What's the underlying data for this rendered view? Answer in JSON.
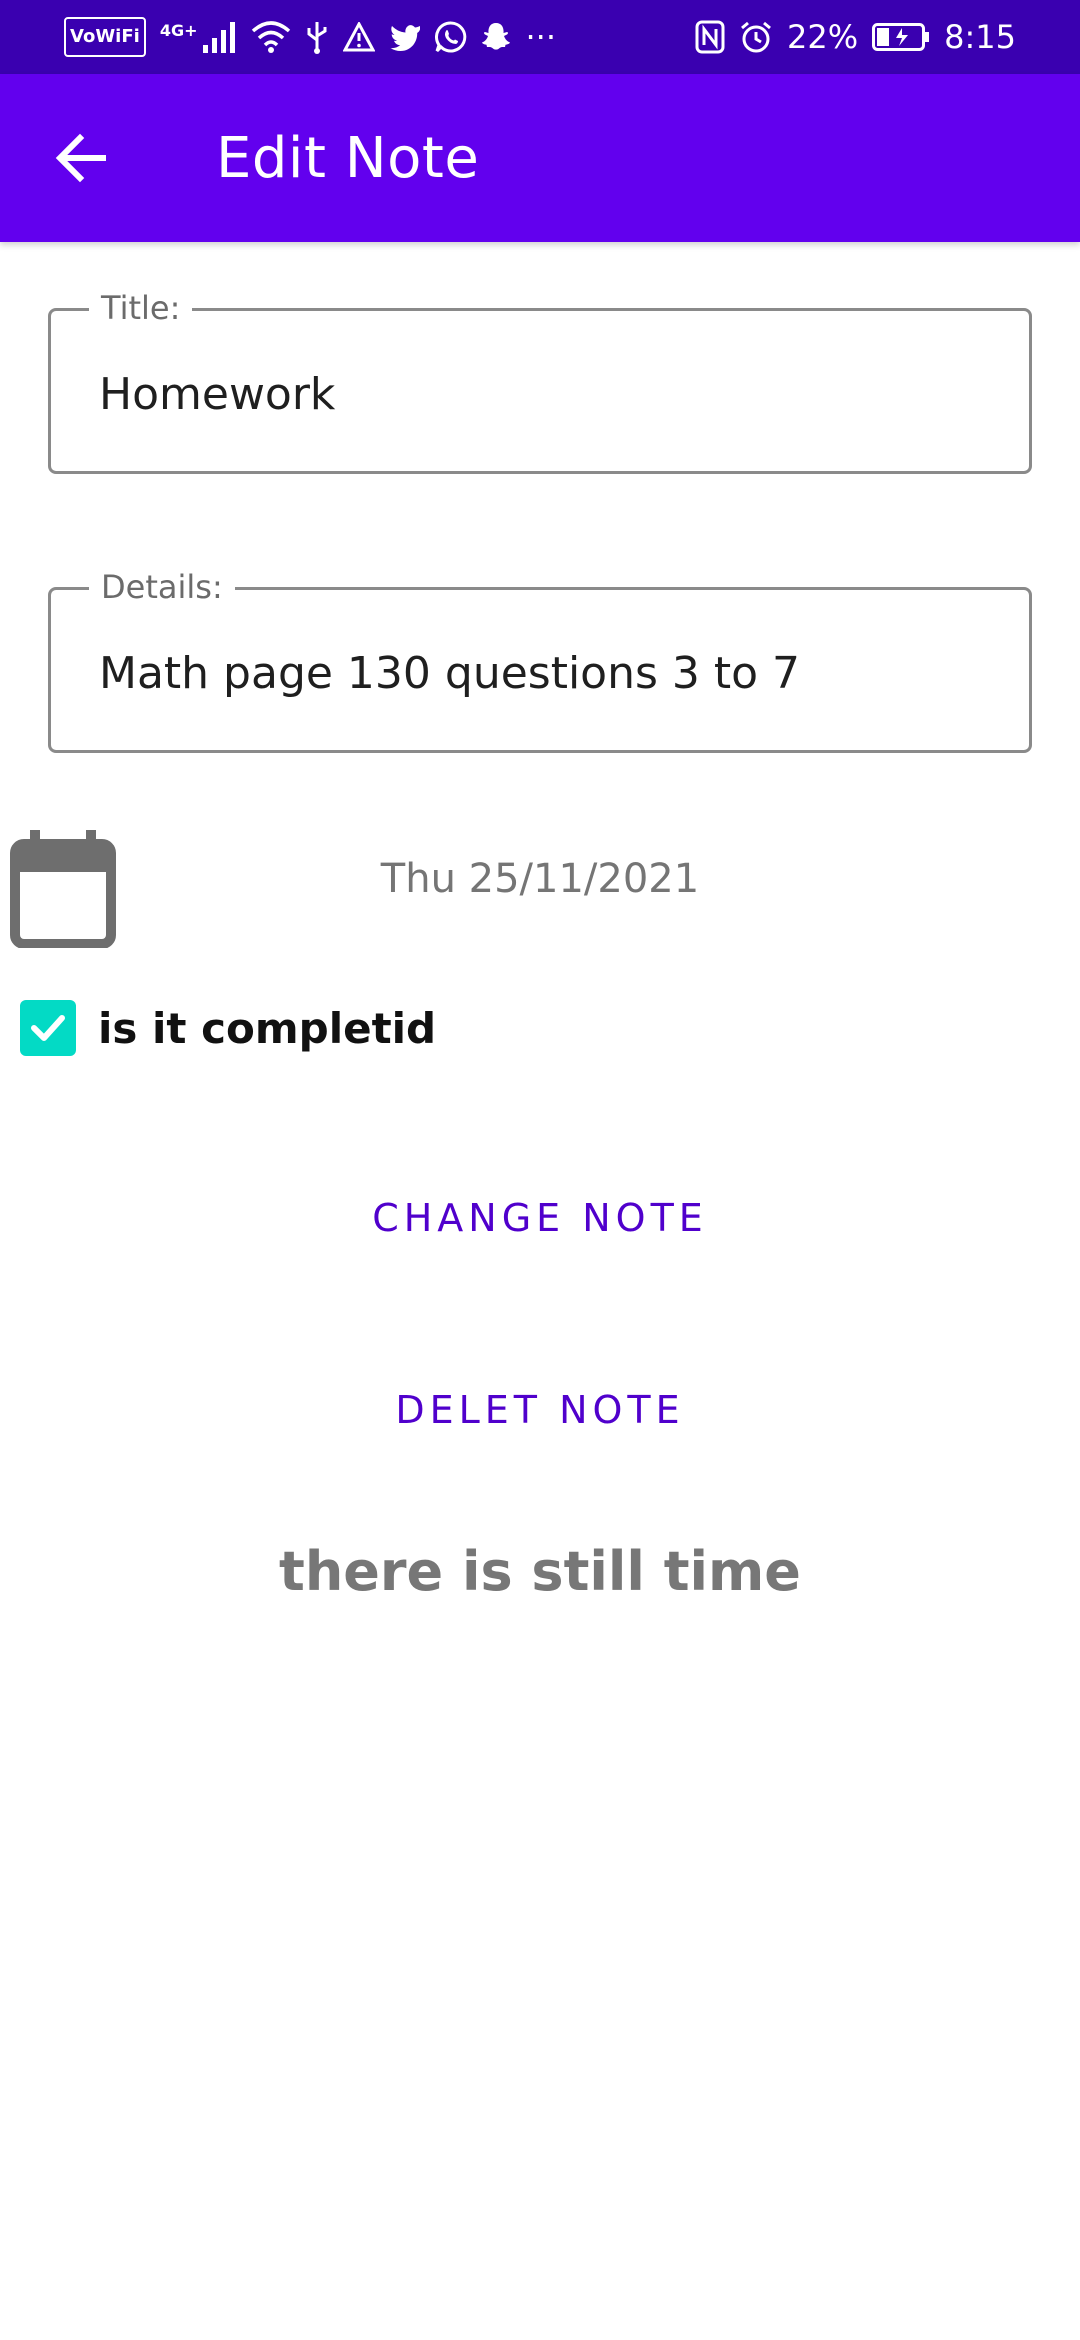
{
  "status_bar": {
    "vowifi": "VoWiFi",
    "network": "4G+",
    "more": "···",
    "battery": "22%",
    "time": "8:15"
  },
  "app_bar": {
    "title": "Edit Note"
  },
  "form": {
    "title_label": "Title:",
    "title_value": "Homework",
    "details_label": "Details:",
    "details_value": "Math page 130 questions 3 to 7",
    "date": "Thu 25/11/2021",
    "completed_label": "is it completid",
    "completed": true
  },
  "actions": {
    "change_label": "CHANGE NOTE",
    "delete_label": "DELET NOTE"
  },
  "message": "there is still time",
  "colors": {
    "status_bar": "#3a00b0",
    "app_bar": "#6200ee",
    "accent": "#03dac5",
    "button_text": "#5000cc"
  }
}
